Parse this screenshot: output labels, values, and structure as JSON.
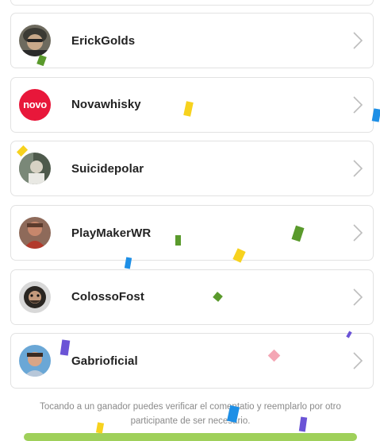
{
  "winners": [
    {
      "name": "ErickGolds",
      "avatar": "photo-avatar"
    },
    {
      "name": "Novawhisky",
      "avatar": "novo-logo",
      "avatar_text": "novo",
      "avatar_color": "#e8173a"
    },
    {
      "name": "Suicidepolar",
      "avatar": "photo-avatar"
    },
    {
      "name": "PlayMakerWR",
      "avatar": "photo-avatar"
    },
    {
      "name": "ColossoFost",
      "avatar": "photo-avatar"
    },
    {
      "name": "Gabrioficial",
      "avatar": "photo-avatar"
    }
  ],
  "footer": {
    "note": "Tocando a un ganador puedes verificar el comentatio y reemplarlo por otro participante de ser necesario."
  },
  "colors": {
    "accent_green": "#9fd05a",
    "confetti": [
      "#f7d21e",
      "#5a9a2c",
      "#1e8fe6",
      "#6b54d6",
      "#f4a6b4"
    ]
  }
}
